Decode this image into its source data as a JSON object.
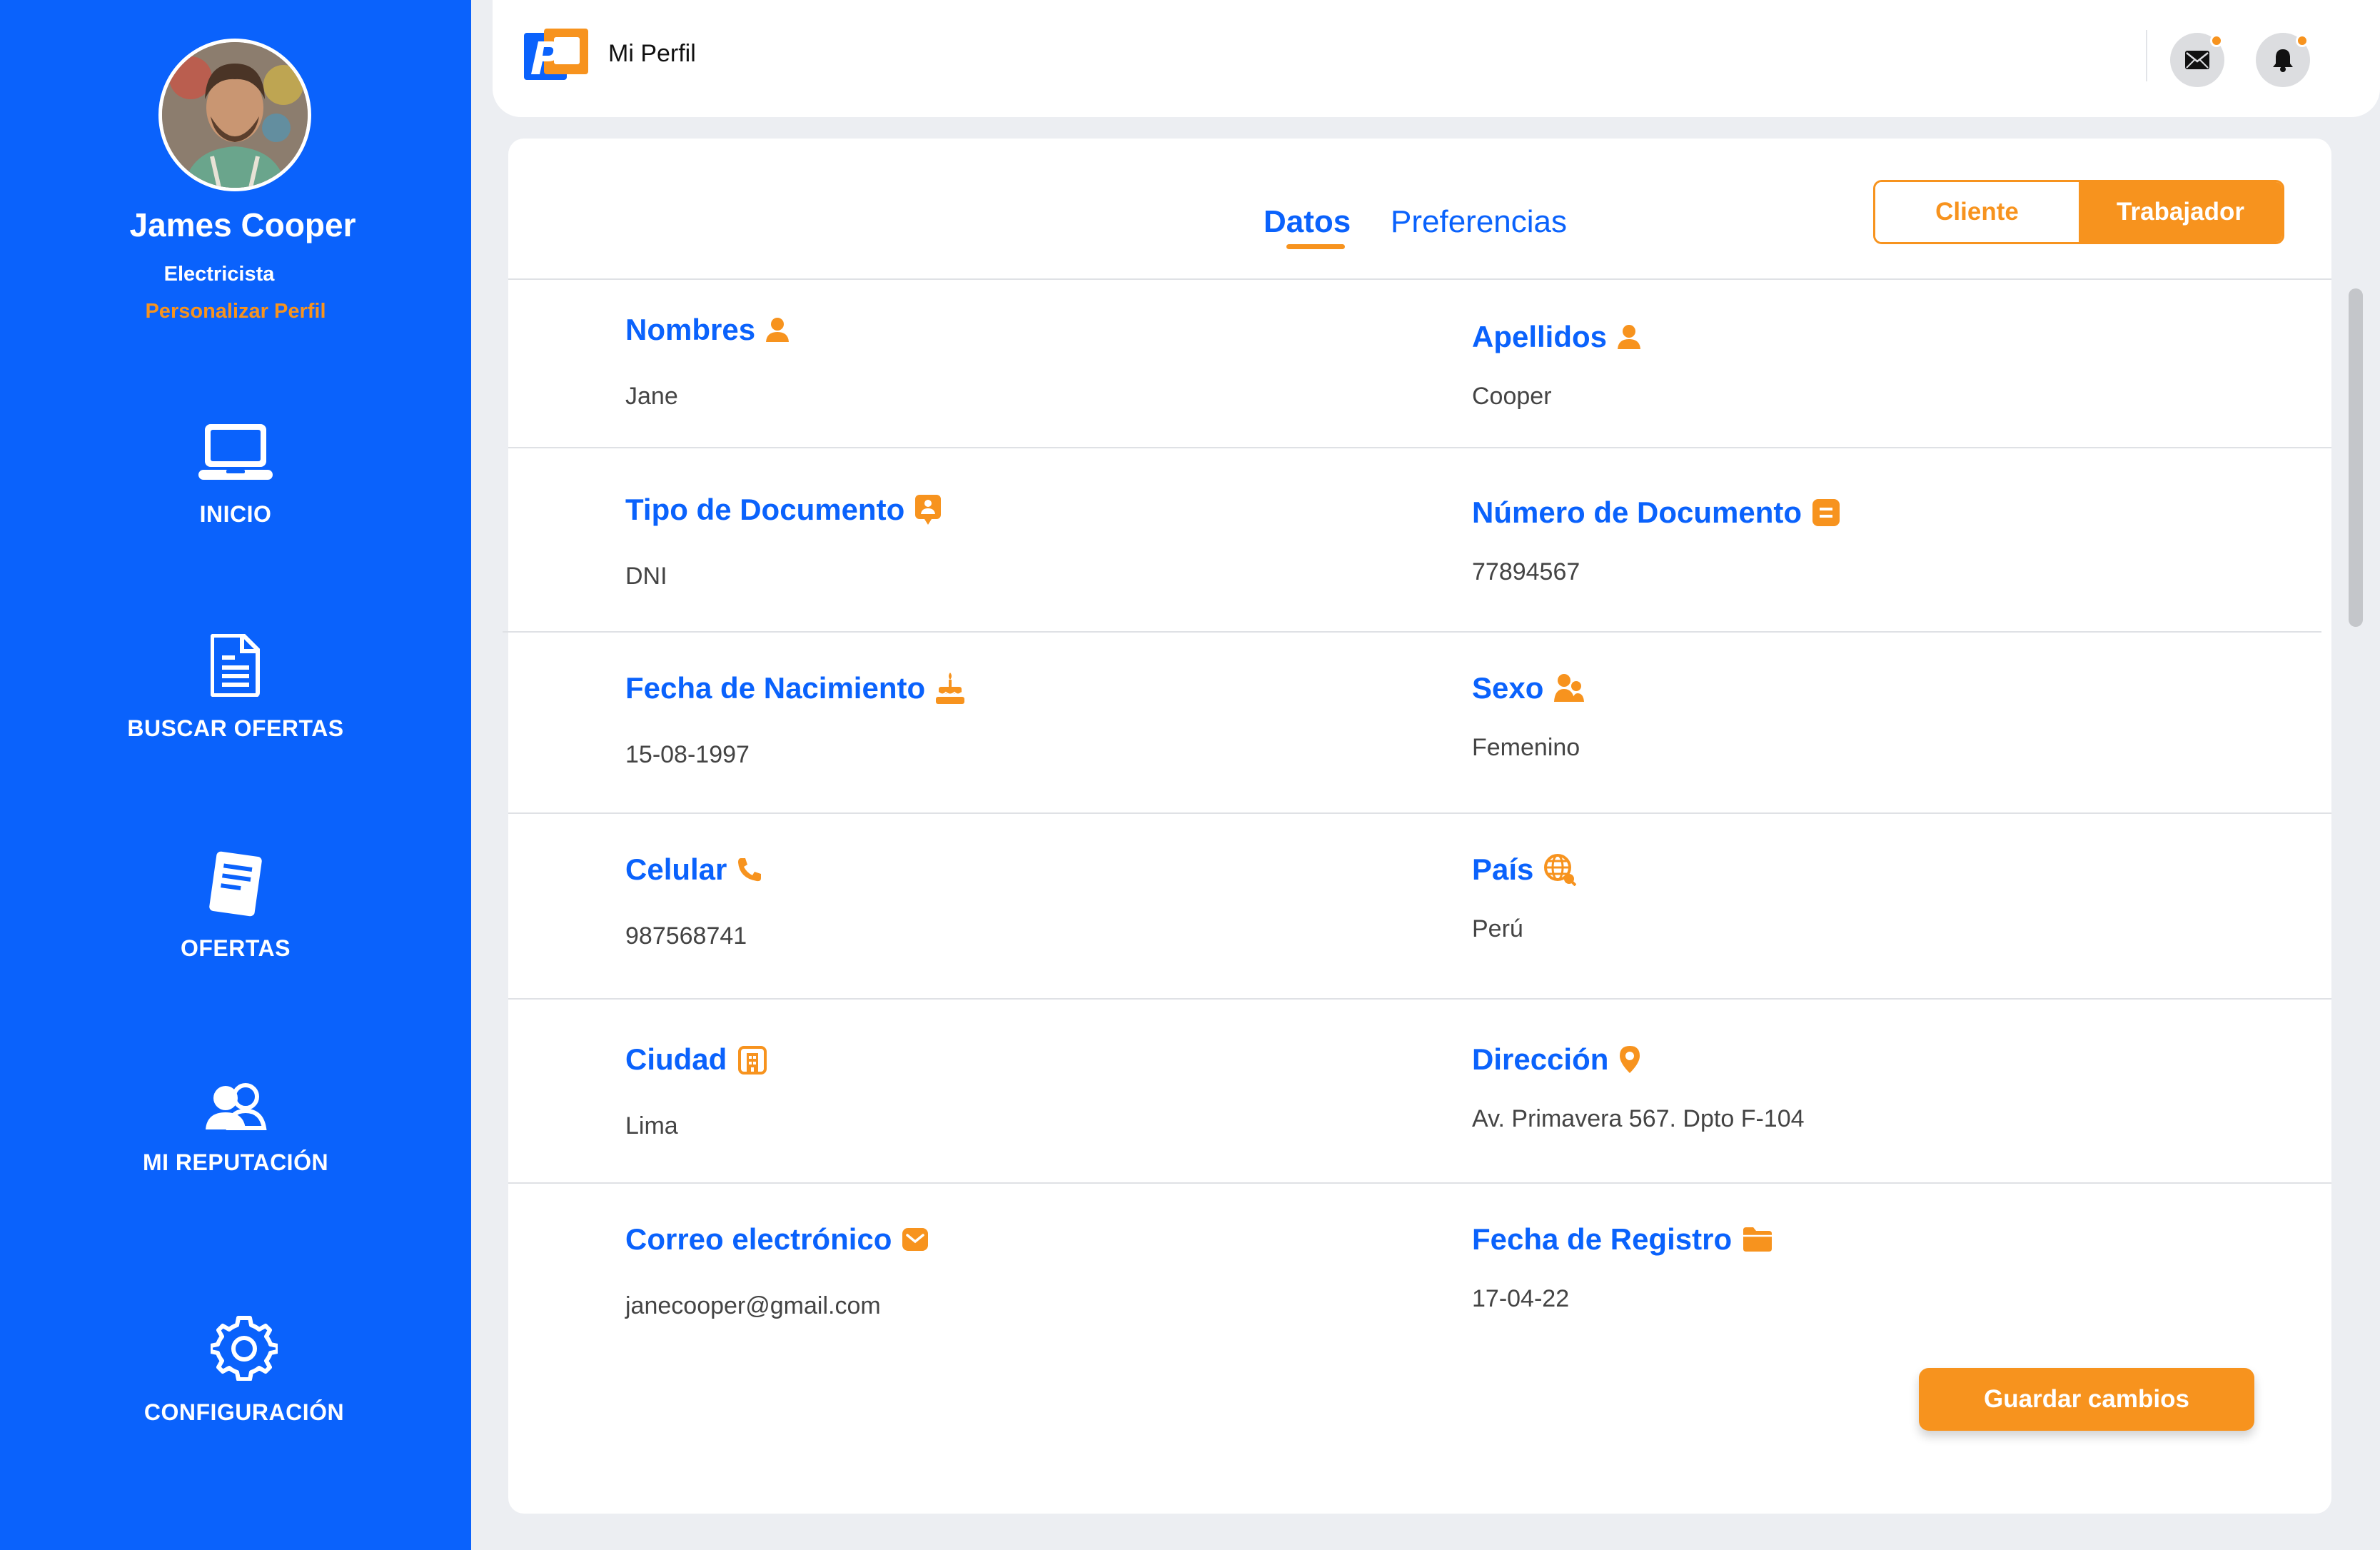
{
  "sidebar": {
    "user_name": "James Cooper",
    "user_role": "Electricista",
    "customize_link": "Personalizar Perfil",
    "items": [
      {
        "label": "INICIO",
        "icon": "laptop-icon"
      },
      {
        "label": "BUSCAR OFERTAS",
        "icon": "document-icon"
      },
      {
        "label": "OFERTAS",
        "icon": "note-icon"
      },
      {
        "label": "MI REPUTACIÓN",
        "icon": "users-icon"
      },
      {
        "label": "CONFIGURACIÓN",
        "icon": "gear-icon"
      }
    ]
  },
  "header": {
    "title": "Mi Perfil",
    "icons": [
      "mail-icon",
      "bell-icon"
    ]
  },
  "tabs": [
    {
      "label": "Datos",
      "active": true
    },
    {
      "label": "Preferencias",
      "active": false
    }
  ],
  "toggle": {
    "options": [
      "Cliente",
      "Trabajador"
    ],
    "selected": "Trabajador"
  },
  "fields": [
    {
      "label": "Nombres",
      "value": "Jane",
      "icon": "user-icon"
    },
    {
      "label": "Apellidos",
      "value": "Cooper",
      "icon": "user-icon"
    },
    {
      "label": "Tipo de Documento",
      "value": "DNI",
      "icon": "id-card-icon"
    },
    {
      "label": "Número de Documento",
      "value": "77894567",
      "icon": "document-number-icon"
    },
    {
      "label": "Fecha de Nacimiento",
      "value": "15-08-1997",
      "icon": "cake-icon"
    },
    {
      "label": "Sexo",
      "value": "Femenino",
      "icon": "people-icon"
    },
    {
      "label": "Celular",
      "value": "987568741",
      "icon": "phone-icon"
    },
    {
      "label": "País",
      "value": "Perú",
      "icon": "globe-icon"
    },
    {
      "label": "Ciudad",
      "value": "Lima",
      "icon": "city-icon"
    },
    {
      "label": "Dirección",
      "value": "Av. Primavera 567. Dpto F-104",
      "icon": "location-pin-icon"
    },
    {
      "label": "Correo electrónico",
      "value": "janecooper@gmail.com",
      "icon": "envelope-icon"
    },
    {
      "label": "Fecha de Registro",
      "value": "17-04-22",
      "icon": "folder-icon"
    }
  ],
  "actions": {
    "save_label": "Guardar cambios"
  },
  "colors": {
    "primary": "#0a62fc",
    "accent": "#f7931e",
    "background": "#eceef2"
  }
}
